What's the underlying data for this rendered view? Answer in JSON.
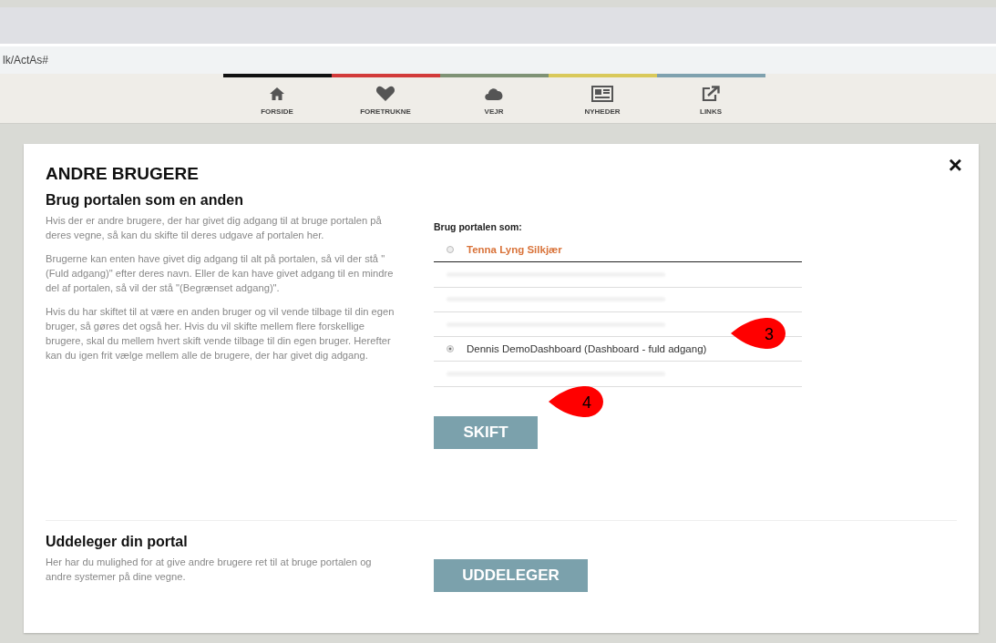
{
  "address_bar": {
    "url": "lk/ActAs#"
  },
  "nav": [
    {
      "label": "FORSIDE",
      "color": "#111111"
    },
    {
      "label": "FORETRUKNE",
      "color": "#d23a3a"
    },
    {
      "label": "VEJR",
      "color": "#7f9275"
    },
    {
      "label": "NYHEDER",
      "color": "#d9c95a"
    },
    {
      "label": "LINKS",
      "color": "#7fa1ae"
    }
  ],
  "dialog": {
    "title": "ANDRE BRUGERE",
    "close": "×",
    "sections": [
      {
        "heading": "Brug portalen som en anden",
        "paragraphs": [
          "Hvis der er andre brugere, der har givet dig adgang til at bruge portalen på deres vegne, så kan du skifte til deres udgave af portalen her.",
          "Brugerne kan enten have givet dig adgang til alt på portalen, så vil der stå \"(Fuld adgang)\" efter deres navn. Eller de kan have givet adgang til en mindre del af portalen, så vil der stå \"(Begrænset adgang)\".",
          "Hvis du har skiftet til at være en anden bruger og vil vende tilbage til din egen bruger, så gøres det også her. Hvis du vil skifte mellem flere forskellige brugere, skal du mellem hvert skift vende tilbage til din egen bruger. Herefter kan du igen frit vælge mellem alle de brugere, der har givet dig adgang."
        ],
        "list_label": "Brug portalen som:",
        "options": [
          {
            "kind": "user",
            "label": "Tenna Lyng Silkjær",
            "selected": false,
            "color": "#d9733a"
          },
          {
            "kind": "redacted",
            "selected": false
          },
          {
            "kind": "redacted",
            "selected": false
          },
          {
            "kind": "redacted",
            "selected": false
          },
          {
            "kind": "user",
            "label": "Dennis DemoDashboard (Dashboard - fuld adgang)",
            "selected": true,
            "color": "#333333"
          },
          {
            "kind": "redacted",
            "selected": false
          }
        ],
        "button": "SKIFT"
      },
      {
        "heading": "Uddeleger din portal",
        "paragraphs": [
          "Her har du mulighed for at give andre brugere ret til at bruge portalen og andre systemer på dine vegne."
        ],
        "button": "UDDELEGER"
      }
    ]
  },
  "callouts": [
    {
      "number": "3"
    },
    {
      "number": "4"
    }
  ]
}
